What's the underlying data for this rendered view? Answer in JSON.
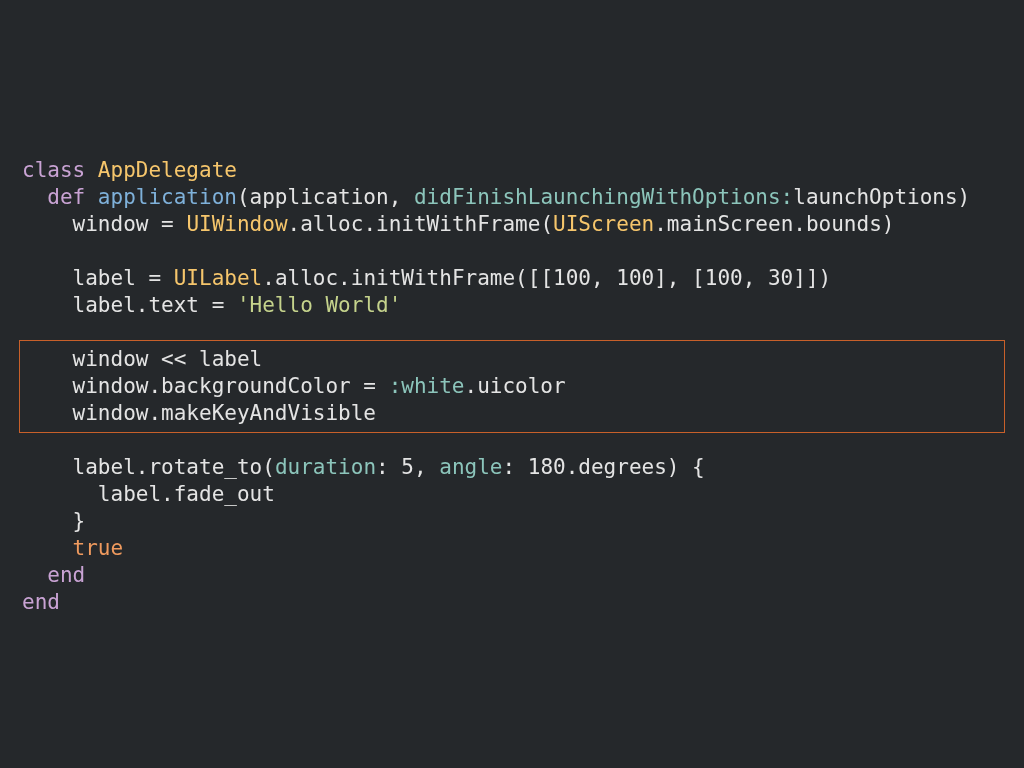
{
  "code_blocks": [
    {
      "highlighted": false,
      "lines": [
        {
          "tokens": [
            {
              "kind": "keyword",
              "text": "class "
            },
            {
              "kind": "constant",
              "text": "AppDelegate"
            }
          ]
        },
        {
          "tokens": [
            {
              "kind": "keyword",
              "text": "  def "
            },
            {
              "kind": "method",
              "text": "application"
            },
            {
              "kind": "plain",
              "text": "(application, "
            },
            {
              "kind": "param",
              "text": "didFinishLaunchingWithOptions:"
            },
            {
              "kind": "plain",
              "text": "launchOptions)"
            }
          ]
        },
        {
          "tokens": [
            {
              "kind": "plain",
              "text": "    window = "
            },
            {
              "kind": "constant",
              "text": "UIWindow"
            },
            {
              "kind": "plain",
              "text": ".alloc.initWithFrame("
            },
            {
              "kind": "constant",
              "text": "UIScreen"
            },
            {
              "kind": "plain",
              "text": ".mainScreen.bounds)"
            }
          ]
        }
      ]
    },
    {
      "highlighted": false,
      "lines": [
        {
          "tokens": [
            {
              "kind": "plain",
              "text": "    label = "
            },
            {
              "kind": "constant",
              "text": "UILabel"
            },
            {
              "kind": "plain",
              "text": ".alloc.initWithFrame([[100, 100], [100, 30]])"
            }
          ]
        },
        {
          "tokens": [
            {
              "kind": "plain",
              "text": "    label.text = "
            },
            {
              "kind": "string",
              "text": "'Hello World'"
            }
          ]
        }
      ]
    },
    {
      "highlighted": true,
      "lines": [
        {
          "tokens": [
            {
              "kind": "plain",
              "text": "    window << label"
            }
          ]
        },
        {
          "tokens": [
            {
              "kind": "plain",
              "text": "    window.backgroundColor = "
            },
            {
              "kind": "param",
              "text": ":white"
            },
            {
              "kind": "plain",
              "text": ".uicolor"
            }
          ]
        },
        {
          "tokens": [
            {
              "kind": "plain",
              "text": "    window.makeKeyAndVisible"
            }
          ]
        }
      ]
    },
    {
      "highlighted": false,
      "lines": [
        {
          "tokens": [
            {
              "kind": "plain",
              "text": "    label.rotate_to("
            },
            {
              "kind": "param",
              "text": "duration"
            },
            {
              "kind": "plain",
              "text": ": 5, "
            },
            {
              "kind": "param",
              "text": "angle"
            },
            {
              "kind": "plain",
              "text": ": 180.degrees) {"
            }
          ]
        },
        {
          "tokens": [
            {
              "kind": "plain",
              "text": "      label.fade_out"
            }
          ]
        },
        {
          "tokens": [
            {
              "kind": "plain",
              "text": "    }"
            }
          ]
        },
        {
          "tokens": [
            {
              "kind": "literal",
              "text": "    true"
            }
          ]
        },
        {
          "tokens": [
            {
              "kind": "keyword",
              "text": "  end"
            }
          ]
        },
        {
          "tokens": [
            {
              "kind": "keyword",
              "text": "end"
            }
          ]
        }
      ]
    }
  ]
}
